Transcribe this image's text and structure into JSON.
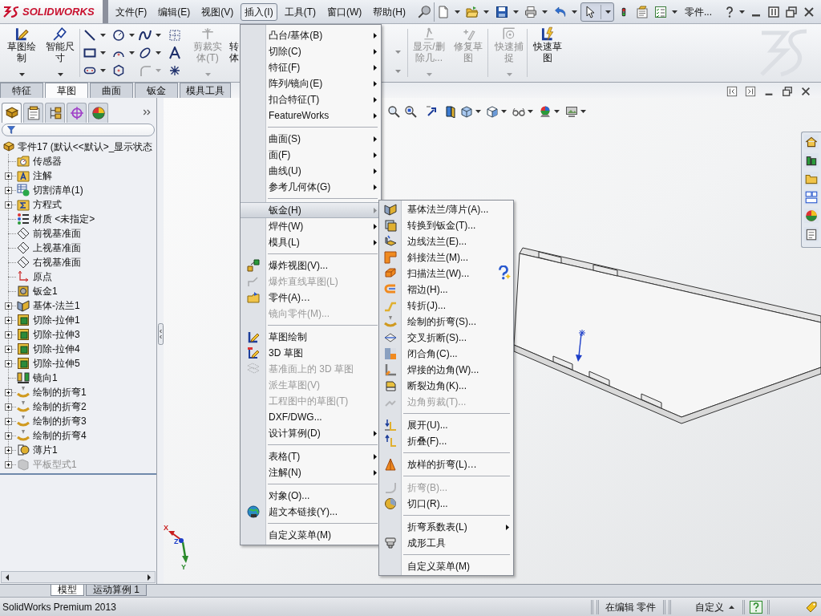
{
  "title_bar": {
    "logo": "SOLIDWORKS",
    "menus": [
      {
        "label": "文件(F)",
        "selected": false
      },
      {
        "label": "编辑(E)",
        "selected": false
      },
      {
        "label": "视图(V)",
        "selected": false
      },
      {
        "label": "插入(I)",
        "selected": true
      },
      {
        "label": "工具(T)",
        "selected": false
      },
      {
        "label": "窗口(W)",
        "selected": false
      },
      {
        "label": "帮助(H)",
        "selected": false
      }
    ],
    "select_tool": {
      "selected": true
    },
    "document": "零件..."
  },
  "command_manager": {
    "buttons_left": [
      {
        "label": "草图绘制",
        "disabled": false,
        "dropdown": true
      },
      {
        "label": "智能尺寸",
        "disabled": false,
        "dropdown": true
      }
    ],
    "sketch_tools": [
      {
        "disabled": false,
        "dropdown": true
      },
      {
        "disabled": false,
        "dropdown": true
      },
      {
        "disabled": false,
        "dropdown": true
      },
      {
        "disabled": false,
        "dropdown": false
      },
      {
        "disabled": false,
        "dropdown": true
      },
      {
        "disabled": false,
        "dropdown": true
      },
      {
        "disabled": false,
        "dropdown": true
      },
      {
        "disabled": false,
        "dropdown": false
      },
      {
        "disabled": false,
        "dropdown": true
      },
      {
        "disabled": false,
        "dropdown": false
      },
      {
        "disabled": true,
        "dropdown": true
      },
      {
        "disabled": false,
        "dropdown": false
      }
    ],
    "buttons_mid": [
      {
        "label": "剪裁实体(T)",
        "disabled": true,
        "dropdown": true
      },
      {
        "label": "转体",
        "disabled": false,
        "dropdown": false
      }
    ],
    "buttons_right": [
      {
        "label": "显示/删除几...",
        "disabled": true,
        "dropdown": true
      },
      {
        "label": "修复草图",
        "disabled": true,
        "dropdown": false
      },
      {
        "label": "快速捕捉",
        "disabled": true,
        "dropdown": true
      },
      {
        "label": "快速草图",
        "disabled": false,
        "dropdown": false
      }
    ]
  },
  "tabs": [
    {
      "label": "特征",
      "selected": false
    },
    {
      "label": "草图",
      "selected": true
    },
    {
      "label": "曲面",
      "selected": false
    },
    {
      "label": "钣金",
      "selected": false
    },
    {
      "label": "模具工具",
      "selected": false
    }
  ],
  "feature_manager": {
    "panel_tabs": [
      {
        "selected": true
      },
      {
        "selected": false
      },
      {
        "selected": false
      },
      {
        "selected": false
      },
      {
        "selected": false
      }
    ],
    "tree": {
      "label": "零件17 (默认<<默认>_显示状态",
      "children": [
        {
          "label": "传感器",
          "expandable": false,
          "disabled": false
        },
        {
          "label": "注解",
          "expandable": true,
          "disabled": false
        },
        {
          "label": "切割清单(1)",
          "expandable": true,
          "disabled": false
        },
        {
          "label": "方程式",
          "expandable": true,
          "disabled": false
        },
        {
          "label": "材质 <未指定>",
          "expandable": false,
          "disabled": false
        },
        {
          "label": "前视基准面",
          "expandable": false,
          "disabled": false
        },
        {
          "label": "上视基准面",
          "expandable": false,
          "disabled": false
        },
        {
          "label": "右视基准面",
          "expandable": false,
          "disabled": false
        },
        {
          "label": "原点",
          "expandable": false,
          "disabled": false
        },
        {
          "label": "钣金1",
          "expandable": false,
          "disabled": false
        },
        {
          "label": "基体-法兰1",
          "expandable": true,
          "disabled": false
        },
        {
          "label": "切除-拉伸1",
          "expandable": true,
          "disabled": false
        },
        {
          "label": "切除-拉伸3",
          "expandable": true,
          "disabled": false
        },
        {
          "label": "切除-拉伸4",
          "expandable": true,
          "disabled": false
        },
        {
          "label": "切除-拉伸5",
          "expandable": true,
          "disabled": false
        },
        {
          "label": "镜向1",
          "expandable": false,
          "disabled": false
        },
        {
          "label": "绘制的折弯1",
          "expandable": true,
          "disabled": false
        },
        {
          "label": "绘制的折弯2",
          "expandable": true,
          "disabled": false
        },
        {
          "label": "绘制的折弯3",
          "expandable": true,
          "disabled": false
        },
        {
          "label": "绘制的折弯4",
          "expandable": true,
          "disabled": false
        },
        {
          "label": "薄片1",
          "expandable": true,
          "disabled": false
        },
        {
          "label": "平板型式1",
          "expandable": true,
          "disabled": true
        }
      ]
    }
  },
  "insert_menu": {
    "sections": [
      [
        {
          "label": "凸台/基体(B)",
          "submenu": true,
          "disabled": false,
          "selected": false
        },
        {
          "label": "切除(C)",
          "submenu": true,
          "disabled": false,
          "selected": false
        },
        {
          "label": "特征(F)",
          "submenu": true,
          "disabled": false,
          "selected": false
        },
        {
          "label": "阵列/镜向(E)",
          "submenu": true,
          "disabled": false,
          "selected": false
        },
        {
          "label": "扣合特征(T)",
          "submenu": true,
          "disabled": false,
          "selected": false
        },
        {
          "label": "FeatureWorks",
          "submenu": true,
          "disabled": false,
          "selected": false
        }
      ],
      [
        {
          "label": "曲面(S)",
          "submenu": true,
          "disabled": false,
          "selected": false
        },
        {
          "label": "面(F)",
          "submenu": true,
          "disabled": false,
          "selected": false
        },
        {
          "label": "曲线(U)",
          "submenu": true,
          "disabled": false,
          "selected": false
        },
        {
          "label": "参考几何体(G)",
          "submenu": true,
          "disabled": false,
          "selected": false
        }
      ],
      [
        {
          "label": "钣金(H)",
          "submenu": true,
          "disabled": false,
          "selected": true
        },
        {
          "label": "焊件(W)",
          "submenu": true,
          "disabled": false,
          "selected": false
        },
        {
          "label": "模具(L)",
          "submenu": true,
          "disabled": false,
          "selected": false
        }
      ],
      [
        {
          "label": "爆炸视图(V)...",
          "submenu": false,
          "disabled": false,
          "selected": false
        },
        {
          "label": "爆炸直线草图(L)",
          "submenu": false,
          "disabled": true,
          "selected": false
        },
        {
          "label": "零件(A)…",
          "submenu": false,
          "disabled": false,
          "selected": false
        },
        {
          "label": "镜向零件(M)...",
          "submenu": false,
          "disabled": true,
          "selected": false
        }
      ],
      [
        {
          "label": "草图绘制",
          "submenu": false,
          "disabled": false,
          "selected": false
        },
        {
          "label": "3D 草图",
          "submenu": false,
          "disabled": false,
          "selected": false
        },
        {
          "label": "基准面上的 3D 草图",
          "submenu": false,
          "disabled": true,
          "selected": false
        },
        {
          "label": "派生草图(V)",
          "submenu": false,
          "disabled": true,
          "selected": false
        },
        {
          "label": "工程图中的草图(T)",
          "submenu": false,
          "disabled": true,
          "selected": false
        },
        {
          "label": "DXF/DWG...",
          "submenu": false,
          "disabled": false,
          "selected": false
        },
        {
          "label": "设计算例(D)",
          "submenu": true,
          "disabled": false,
          "selected": false
        }
      ],
      [
        {
          "label": "表格(T)",
          "submenu": true,
          "disabled": false,
          "selected": false
        },
        {
          "label": "注解(N)",
          "submenu": true,
          "disabled": false,
          "selected": false
        }
      ],
      [
        {
          "label": "对象(O)...",
          "submenu": false,
          "disabled": false,
          "selected": false
        },
        {
          "label": "超文本链接(Y)...",
          "submenu": false,
          "disabled": false,
          "selected": false
        }
      ],
      [
        {
          "label": "自定义菜单(M)",
          "submenu": false,
          "disabled": false,
          "selected": false
        }
      ]
    ]
  },
  "sheet_metal_menu": {
    "sections": [
      [
        {
          "label": "基体法兰/薄片(A)...",
          "submenu": false,
          "disabled": false
        },
        {
          "label": "转换到钣金(T)...",
          "submenu": false,
          "disabled": false
        },
        {
          "label": "边线法兰(E)...",
          "submenu": false,
          "disabled": false
        },
        {
          "label": "斜接法兰(M)...",
          "submenu": false,
          "disabled": false
        },
        {
          "label": "扫描法兰(W)...",
          "submenu": false,
          "disabled": false
        },
        {
          "label": "褶边(H)...",
          "submenu": false,
          "disabled": false
        },
        {
          "label": "转折(J)...",
          "submenu": false,
          "disabled": false
        },
        {
          "label": "绘制的折弯(S)...",
          "submenu": false,
          "disabled": false
        },
        {
          "label": "交叉折断(S)...",
          "submenu": false,
          "disabled": false
        },
        {
          "label": "闭合角(C)...",
          "submenu": false,
          "disabled": false
        },
        {
          "label": "焊接的边角(W)...",
          "submenu": false,
          "disabled": false
        },
        {
          "label": "断裂边角(K)...",
          "submenu": false,
          "disabled": false
        },
        {
          "label": "边角剪裁(T)...",
          "submenu": false,
          "disabled": true
        }
      ],
      [
        {
          "label": "展开(U)...",
          "submenu": false,
          "disabled": false
        },
        {
          "label": "折叠(F)...",
          "submenu": false,
          "disabled": false
        }
      ],
      [
        {
          "label": "放样的折弯(L)…",
          "submenu": false,
          "disabled": false
        }
      ],
      [
        {
          "label": "折弯(B)...",
          "submenu": false,
          "disabled": true
        },
        {
          "label": "切口(R)...",
          "submenu": false,
          "disabled": false
        }
      ],
      [
        {
          "label": "折弯系数表(L)",
          "submenu": true,
          "disabled": false
        },
        {
          "label": "成形工具",
          "submenu": false,
          "disabled": false
        }
      ],
      [
        {
          "label": "自定义菜单(M)",
          "submenu": false,
          "disabled": false
        }
      ]
    ]
  },
  "viewport": {
    "triad": {
      "x": "X",
      "y": "Y",
      "z": "Z"
    }
  },
  "bottom_tabs": [
    {
      "label": "模型",
      "selected": true
    },
    {
      "label": "运动算例 1",
      "selected": false
    }
  ],
  "status_bar": {
    "product": "SolidWorks Premium 2013",
    "mode": "在编辑 零件",
    "units": "自定义"
  }
}
